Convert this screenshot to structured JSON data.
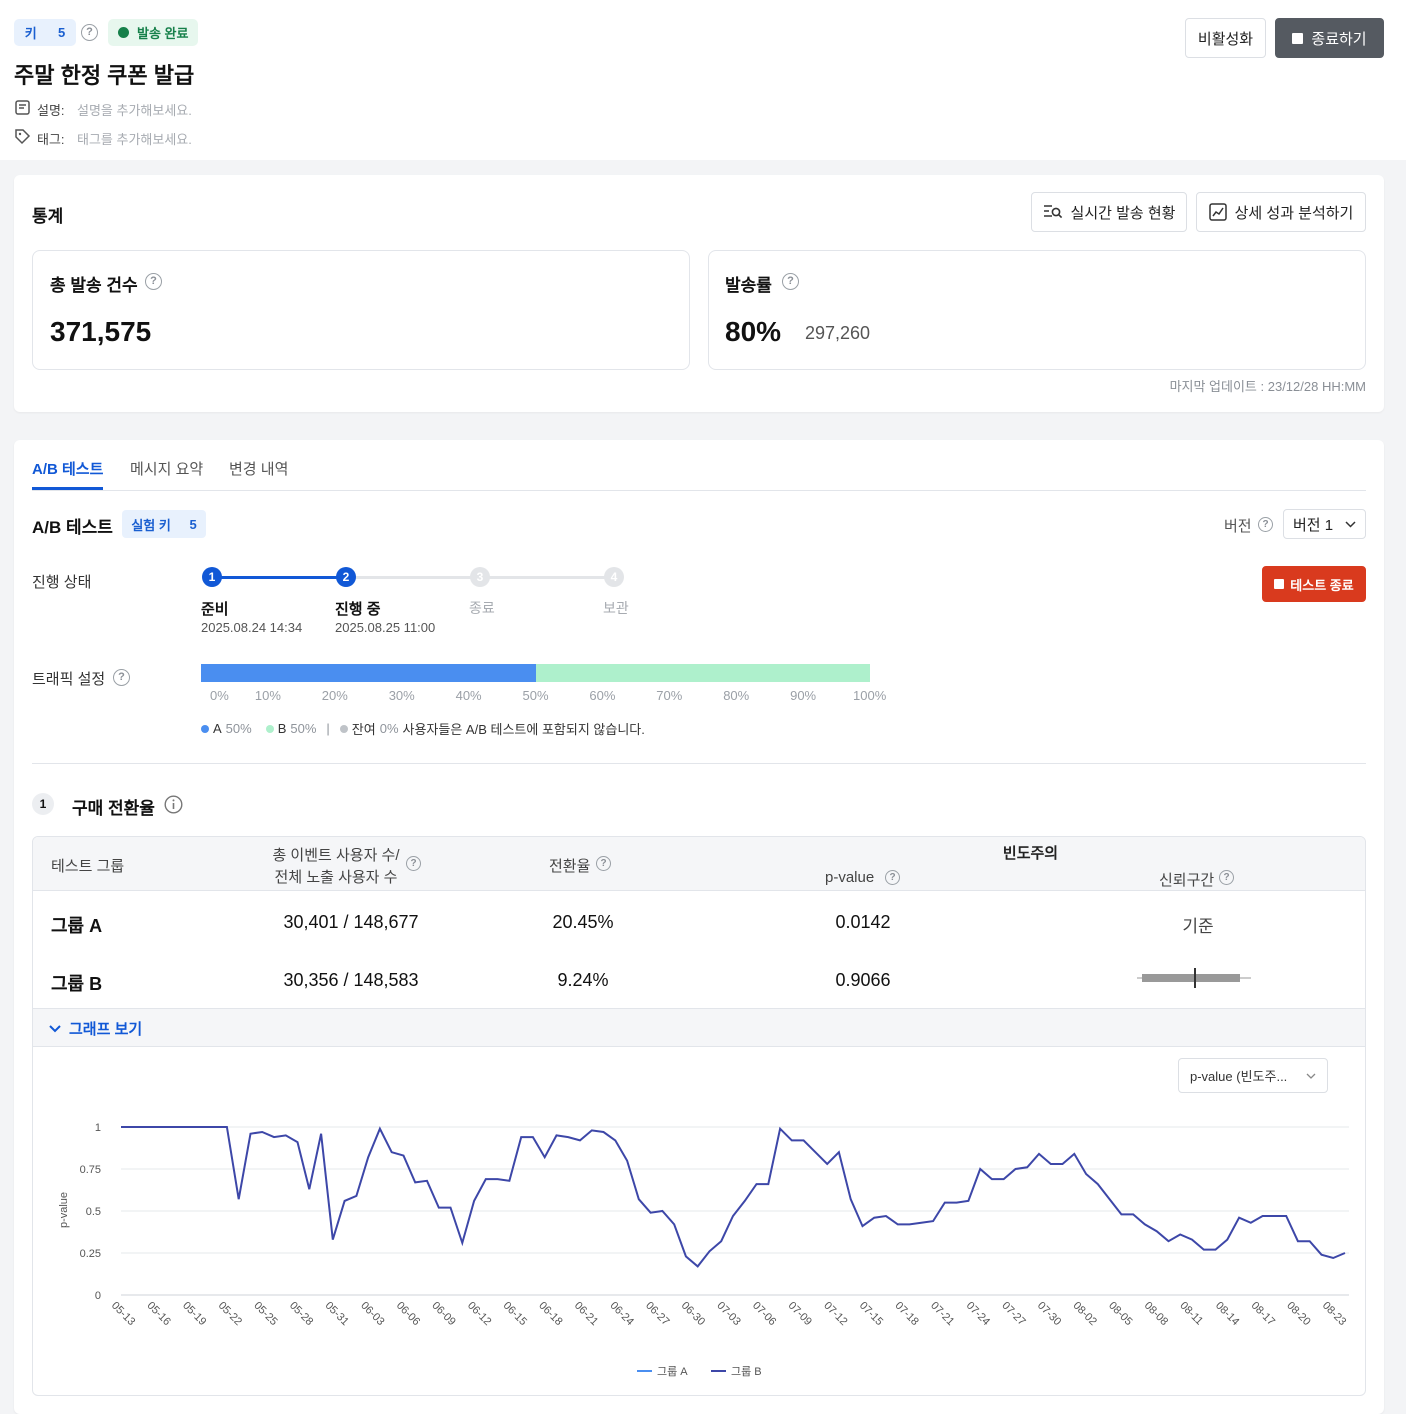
{
  "header": {
    "key_label": "키",
    "key_value": "5",
    "status": "발송 완료",
    "title": "주말 한정 쿠폰 발급",
    "desc_label": "설명:",
    "desc_placeholder": "설명을 추가해보세요.",
    "tag_label": "태그:",
    "tag_placeholder": "태그를 추가해보세요.",
    "deactivate": "비활성화",
    "end": "종료하기"
  },
  "stats": {
    "title": "통계",
    "realtime_btn": "실시간 발송 현황",
    "analysis_btn": "상세 성과 분석하기",
    "total_label": "총 발송 건수",
    "total_value": "371,575",
    "rate_label": "발송률",
    "rate_value": "80%",
    "rate_count": "297,260",
    "updated": "마지막 업데이트 : 23/12/28 HH:MM"
  },
  "tabs": [
    "A/B 테스트",
    "메시지 요약",
    "변경 내역"
  ],
  "ab": {
    "title": "A/B 테스트",
    "exp_key_label": "실험 키",
    "exp_key_value": "5",
    "version_label": "버전",
    "version_value": "버전 1",
    "progress_label": "진행 상태",
    "end_test": "테스트 종료",
    "steps": [
      {
        "num": "1",
        "name": "준비",
        "date": "2025.08.24 14:34"
      },
      {
        "num": "2",
        "name": "진행 중",
        "date": "2025.08.25 11:00"
      },
      {
        "num": "3",
        "name": "종료",
        "date": ""
      },
      {
        "num": "4",
        "name": "보관",
        "date": ""
      }
    ],
    "traffic_label": "트래픽 설정",
    "traffic": {
      "a": 50,
      "b": 50,
      "rest": 0
    },
    "ticks": [
      "0%",
      "10%",
      "20%",
      "30%",
      "40%",
      "50%",
      "60%",
      "70%",
      "80%",
      "90%",
      "100%"
    ],
    "legend": {
      "a": "A",
      "a_pct": "50%",
      "b": "B",
      "b_pct": "50%",
      "sep": "|",
      "rest": "잔여",
      "rest_pct": "0%",
      "note": "사용자들은 A/B 테스트에 포함되지 않습니다."
    },
    "colors": {
      "a": "#4a8ef0",
      "b": "#aef0cc",
      "rest": "#cfd3d8",
      "danger": "#d93a1e",
      "primary": "#1158d6"
    }
  },
  "metric": {
    "num": "1",
    "title": "구매 전환율",
    "headers": {
      "group": "테스트 그룹",
      "users_1": "총 이벤트 사용자 수/",
      "users_2": "전체 노출 사용자 수",
      "rate": "전환율",
      "freq": "빈도주의",
      "pvalue": "p-value",
      "ci": "신뢰구간"
    },
    "rows": [
      {
        "group": "그룹 A",
        "users": "30,401 / 148,677",
        "rate": "20.45%",
        "pvalue": "0.0142",
        "ci": "기준"
      },
      {
        "group": "그룹 B",
        "users": "30,356 / 148,583",
        "rate": "9.24%",
        "pvalue": "0.9066",
        "ci": ""
      }
    ],
    "graph_toggle": "그래프 보기",
    "select": "p-value (빈도주..."
  },
  "chart_data": {
    "type": "line",
    "ylabel": "p-value",
    "ylim": [
      0,
      1
    ],
    "yticks": [
      "0",
      "0.25",
      "0.5",
      "0.75",
      "1"
    ],
    "x": [
      "05-13",
      "05-16",
      "05-19",
      "05-22",
      "05-25",
      "05-28",
      "05-31",
      "06-03",
      "06-06",
      "06-09",
      "06-12",
      "06-15",
      "06-18",
      "06-21",
      "06-24",
      "06-27",
      "06-30",
      "07-03",
      "07-06",
      "07-09",
      "07-12",
      "07-15",
      "07-18",
      "07-21",
      "07-24",
      "07-27",
      "07-30",
      "08-02",
      "08-05",
      "08-08",
      "08-11",
      "08-14",
      "08-17",
      "08-20",
      "08-23"
    ],
    "series": [
      {
        "name": "그룹 A",
        "color": "#4a8ef0",
        "values": []
      },
      {
        "name": "그룹 B",
        "color": "#3d47a8",
        "values": [
          1,
          1,
          1,
          1,
          1,
          1,
          1,
          1,
          1,
          1,
          0.57,
          0.96,
          0.97,
          0.94,
          0.95,
          0.91,
          0.63,
          0.96,
          0.33,
          0.56,
          0.59,
          0.82,
          0.99,
          0.85,
          0.83,
          0.67,
          0.68,
          0.52,
          0.52,
          0.31,
          0.56,
          0.69,
          0.69,
          0.68,
          0.94,
          0.94,
          0.82,
          0.95,
          0.94,
          0.92,
          0.98,
          0.97,
          0.92,
          0.8,
          0.57,
          0.49,
          0.5,
          0.42,
          0.23,
          0.17,
          0.26,
          0.32,
          0.47,
          0.56,
          0.66,
          0.66,
          0.99,
          0.92,
          0.92,
          0.85,
          0.78,
          0.85,
          0.57,
          0.41,
          0.46,
          0.47,
          0.42,
          0.42,
          0.43,
          0.44,
          0.55,
          0.55,
          0.56,
          0.75,
          0.69,
          0.69,
          0.75,
          0.76,
          0.84,
          0.78,
          0.78,
          0.84,
          0.72,
          0.66,
          0.57,
          0.48,
          0.48,
          0.42,
          0.38,
          0.32,
          0.36,
          0.33,
          0.27,
          0.27,
          0.33,
          0.46,
          0.43,
          0.47,
          0.47,
          0.47,
          0.32,
          0.32,
          0.24,
          0.22,
          0.25
        ]
      }
    ]
  }
}
